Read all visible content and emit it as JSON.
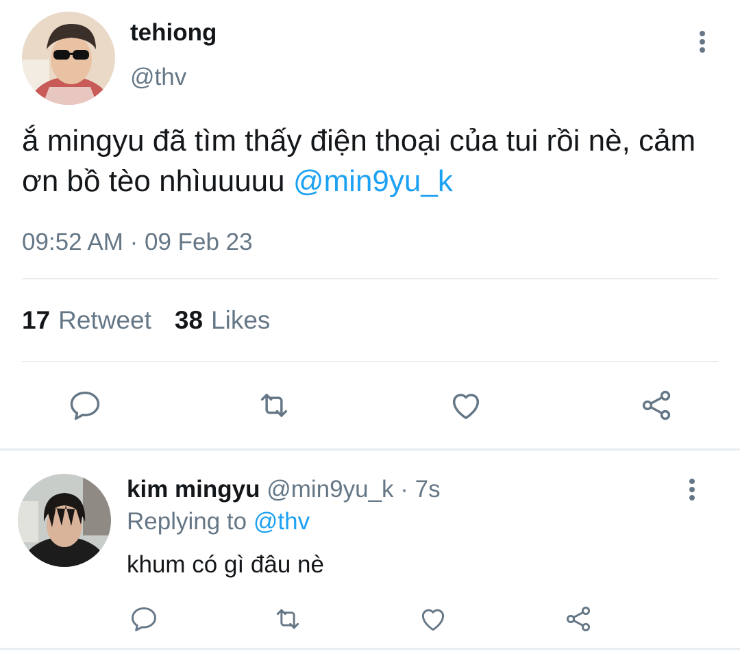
{
  "main_tweet": {
    "display_name": "tehiong",
    "handle": "@thv",
    "text": "ắ mingyu đã tìm thấy điện thoại của tui rồi nè, cảm ơn bồ tèo nhìuuuuu",
    "mention": "@min9yu_k",
    "timestamp": "09:52 AM · 09 Feb 23",
    "retweet_count": "17",
    "retweet_label": "Retweet",
    "likes_count": "38",
    "likes_label": "Likes",
    "avatar_icon": "avatar-photo"
  },
  "reply": {
    "display_name": "kim mingyu",
    "handle": "@min9yu_k",
    "dot": "·",
    "time": "7s",
    "replying_prefix": "Replying to",
    "replying_handle": "@thv",
    "text": "khum có gì đâu nè",
    "avatar_icon": "avatar-photo"
  },
  "actions": [
    "reply-icon",
    "retweet-icon",
    "like-icon",
    "share-icon"
  ],
  "colors": {
    "accent": "#1da1f2",
    "muted": "#657786",
    "text": "#14171a",
    "divider": "#e6ecf0"
  }
}
